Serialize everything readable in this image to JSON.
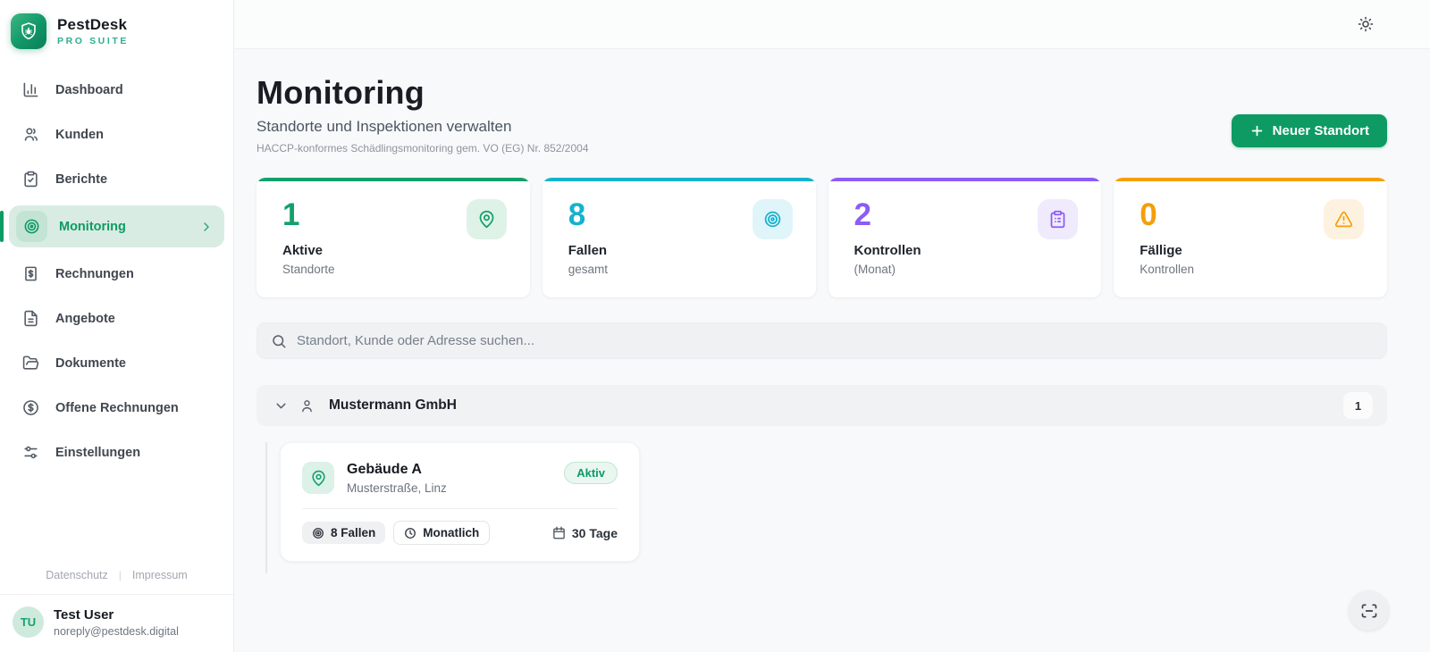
{
  "brand": {
    "name": "PestDesk",
    "suite": "PRO SUITE"
  },
  "sidebar": {
    "items": [
      {
        "label": "Dashboard",
        "icon": "bar-chart-icon",
        "active": false
      },
      {
        "label": "Kunden",
        "icon": "users-icon",
        "active": false
      },
      {
        "label": "Berichte",
        "icon": "clipboard-check-icon",
        "active": false
      },
      {
        "label": "Monitoring",
        "icon": "radar-icon",
        "active": true
      },
      {
        "label": "Rechnungen",
        "icon": "invoice-icon",
        "active": false
      },
      {
        "label": "Angebote",
        "icon": "file-text-icon",
        "active": false
      },
      {
        "label": "Dokumente",
        "icon": "folder-icon",
        "active": false
      },
      {
        "label": "Offene Rechnungen",
        "icon": "dollar-circle-icon",
        "active": false
      },
      {
        "label": "Einstellungen",
        "icon": "sliders-icon",
        "active": false
      }
    ],
    "legal": {
      "privacy": "Datenschutz",
      "imprint": "Impressum"
    },
    "user": {
      "initials": "TU",
      "name": "Test User",
      "email": "noreply@pestdesk.digital"
    }
  },
  "header": {
    "title": "Monitoring",
    "subtitle": "Standorte und Inspektionen verwalten",
    "note": "HACCP-konformes Schädlingsmonitoring gem. VO (EG) Nr. 852/2004",
    "new_site_button": "Neuer Standort"
  },
  "stats": [
    {
      "value": "1",
      "label": "Aktive",
      "sublabel": "Standorte",
      "icon": "map-pin-icon",
      "accent": "#13a06a"
    },
    {
      "value": "8",
      "label": "Fallen",
      "sublabel": "gesamt",
      "icon": "target-icon",
      "accent": "#16b2cc"
    },
    {
      "value": "2",
      "label": "Kontrollen",
      "sublabel": "(Monat)",
      "icon": "clipboard-list-icon",
      "accent": "#8b5cf6"
    },
    {
      "value": "0",
      "label": "Fällige",
      "sublabel": "Kontrollen",
      "icon": "alert-triangle-icon",
      "accent": "#f59e0b"
    }
  ],
  "search": {
    "placeholder": "Standort, Kunde oder Adresse suchen..."
  },
  "group": {
    "name": "Mustermann GmbH",
    "count": "1"
  },
  "site": {
    "name": "Gebäude A",
    "address": "Musterstraße, Linz",
    "status": "Aktiv",
    "traps": "8 Fallen",
    "interval": "Monatlich",
    "due": "30 Tage"
  },
  "colors": {
    "primary_green": "#0d9b63",
    "stat_green": "#13a06a",
    "stat_cyan": "#16b2cc",
    "stat_purple": "#8b5cf6",
    "stat_orange": "#f59e0b",
    "active_nav_bg": "#d9ece3",
    "status_badge_bg": "#e9f7f0"
  }
}
